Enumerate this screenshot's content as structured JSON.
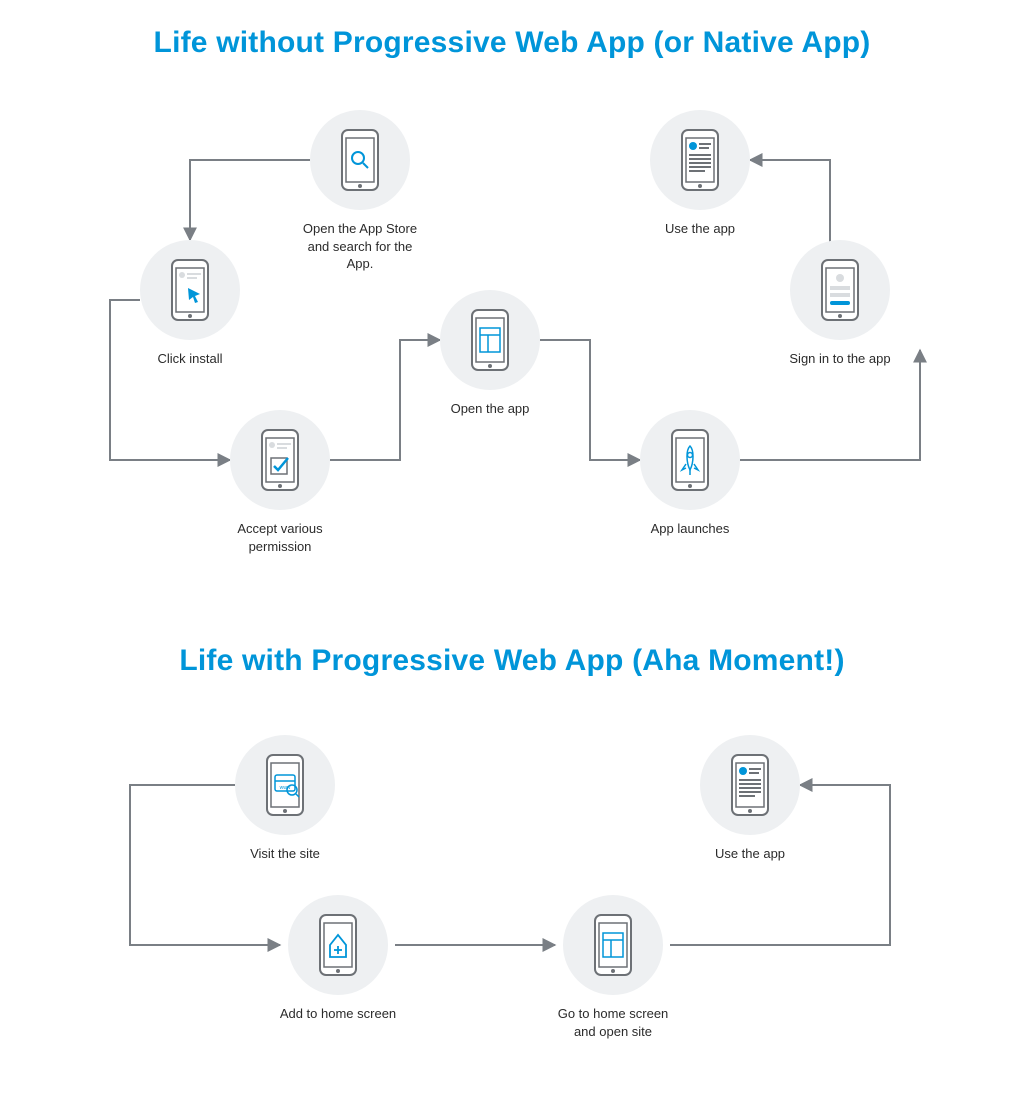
{
  "titles": {
    "without": "Life without Progressive Web App (or Native App)",
    "with": "Life with Progressive Web App (Aha Moment!)"
  },
  "colors": {
    "title": "#0095d9",
    "bubble": "#eef0f2",
    "accent": "#0095d9",
    "line": "#7a7f85",
    "phone_stroke": "#6d7176"
  },
  "flow_without": {
    "nodes": {
      "search": {
        "label": "Open the App Store and search for the App.",
        "icon": "search"
      },
      "install": {
        "label": "Click install",
        "icon": "cursor"
      },
      "accept": {
        "label": "Accept various permission",
        "icon": "checkbox"
      },
      "open": {
        "label": "Open the app",
        "icon": "layout"
      },
      "launch": {
        "label": "App launches",
        "icon": "rocket"
      },
      "signin": {
        "label": "Sign in to the app",
        "icon": "form"
      },
      "use": {
        "label": "Use the app",
        "icon": "content"
      }
    },
    "edges": [
      [
        "search",
        "install"
      ],
      [
        "install",
        "accept"
      ],
      [
        "accept",
        "open"
      ],
      [
        "open",
        "launch"
      ],
      [
        "launch",
        "signin"
      ],
      [
        "signin",
        "use"
      ]
    ]
  },
  "flow_with": {
    "nodes": {
      "visit": {
        "label": "Visit the site",
        "icon": "www"
      },
      "add": {
        "label": "Add to home screen",
        "icon": "home-plus"
      },
      "goto": {
        "label": "Go to home screen and open site",
        "icon": "layout"
      },
      "use2": {
        "label": "Use the app",
        "icon": "content"
      }
    },
    "edges": [
      [
        "visit",
        "add"
      ],
      [
        "add",
        "goto"
      ],
      [
        "goto",
        "use2"
      ]
    ]
  }
}
